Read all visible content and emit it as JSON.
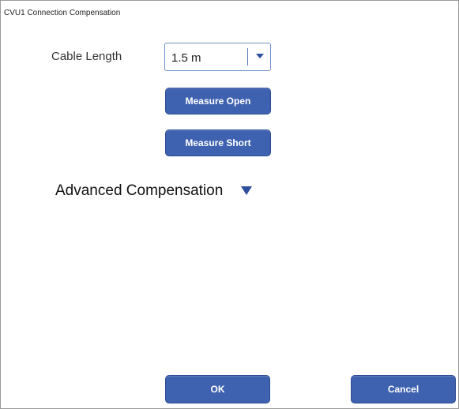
{
  "window": {
    "title": "CVU1 Connection Compensation"
  },
  "cable_length": {
    "label": "Cable Length",
    "selected_value": "1.5 m",
    "dropdown_icon": "triangle-down-icon"
  },
  "buttons": {
    "measure_open": "Measure Open",
    "measure_short": "Measure Short",
    "ok": "OK",
    "cancel": "Cancel"
  },
  "advanced": {
    "label": "Advanced Compensation",
    "expand_icon": "triangle-down-icon"
  },
  "colors": {
    "button_bg": "#3f62b0",
    "accent_arrow": "#2d4f9e",
    "border": "#9a9a9a"
  }
}
